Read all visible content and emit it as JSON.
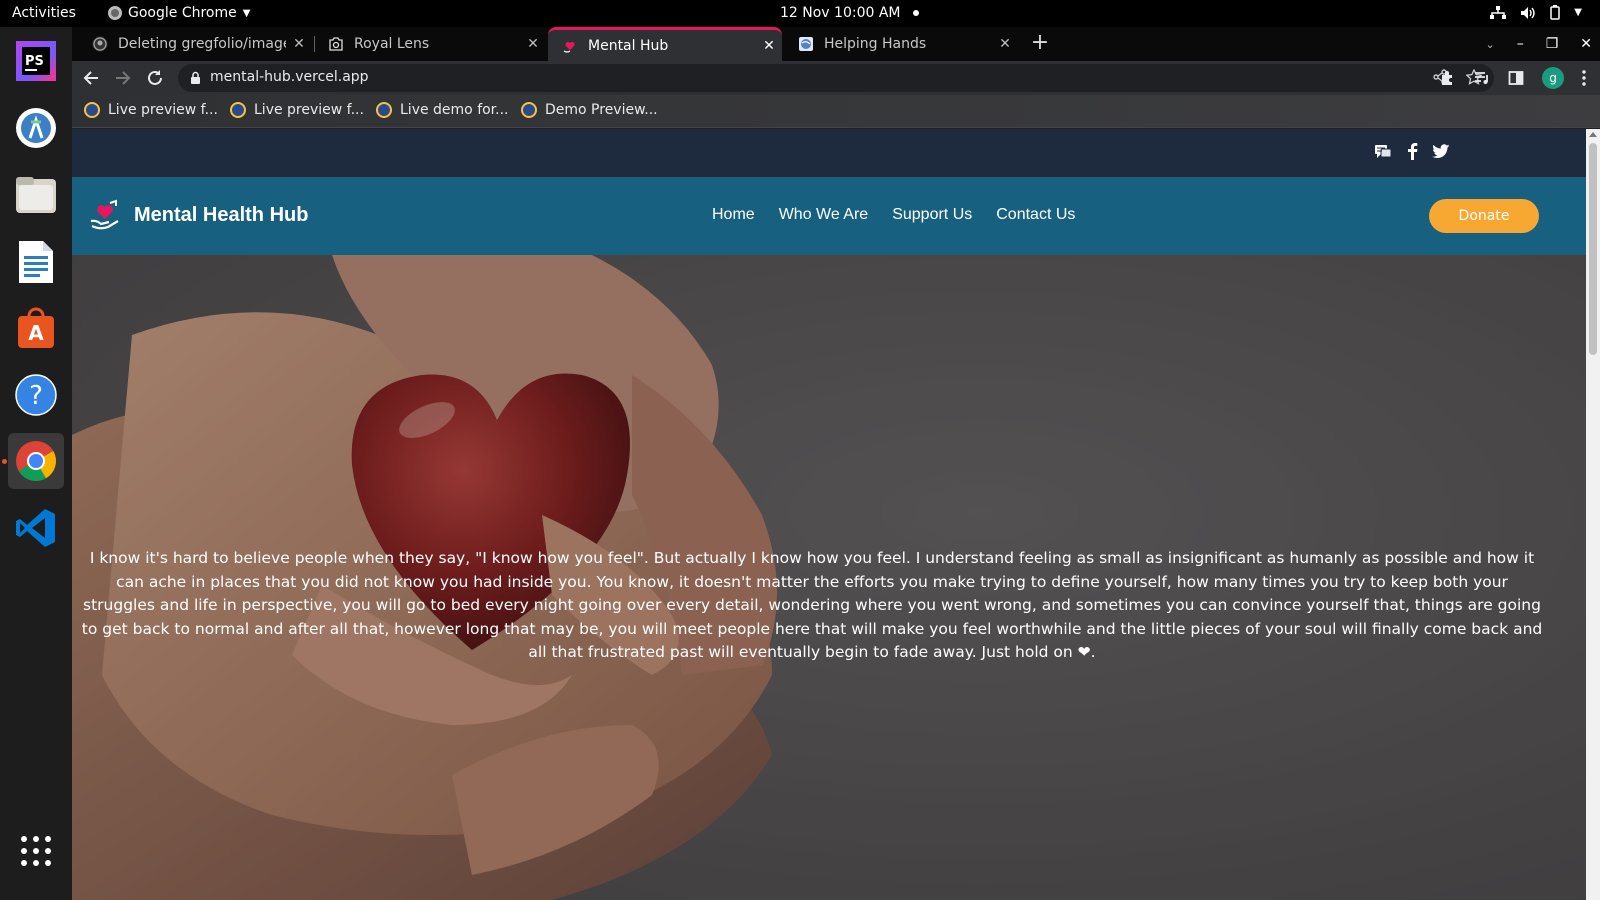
{
  "system": {
    "activities_label": "Activities",
    "app_menu_label": "Google Chrome",
    "clock": "12 Nov  10:00 AM"
  },
  "dock": {
    "apps": [
      "phpstorm-icon",
      "android-studio-icon",
      "files-icon",
      "writer-icon",
      "software-icon",
      "help-icon",
      "chrome-icon",
      "vscode-icon",
      "app-grid-icon"
    ]
  },
  "browser": {
    "tabs": [
      {
        "title": "Deleting gregfolio/image",
        "icon": "github-icon",
        "active": false
      },
      {
        "title": "Royal Lens",
        "icon": "camera-icon",
        "active": false
      },
      {
        "title": "Mental Hub",
        "icon": "heart-hands-icon",
        "active": true
      },
      {
        "title": "Helping Hands",
        "icon": "globe-icon",
        "active": false
      }
    ],
    "url": "mental-hub.vercel.app",
    "bookmarks": [
      {
        "label": "Live preview f..."
      },
      {
        "label": "Live preview f..."
      },
      {
        "label": "Live demo for..."
      },
      {
        "label": "Demo Preview..."
      }
    ],
    "profile_initial": "g"
  },
  "page": {
    "social_icons": [
      "chat-icon",
      "facebook-icon",
      "twitter-icon"
    ],
    "brand_name": "Mental Health Hub",
    "nav": {
      "home": "Home",
      "who_we_are": "Who We Are",
      "support_us": "Support Us",
      "contact_us": "Contact Us"
    },
    "donate_label": "Donate",
    "hero_text": "I know it's hard to believe people when they say, \"I know how you feel\". But actually I know how you feel. I understand feeling as small as insignificant as humanly as possible and how it can ache in places that you did not know you had inside you. You know, it doesn't matter the efforts you make trying to define yourself, how many times you try to keep both your struggles and life in perspective, you will go to bed every night going over every detail, wondering where you went wrong, and sometimes you can convince yourself that, things are going to get back to normal and after all that, however long that may be, you will meet people here that will make you feel worthwhile and the little pieces of your soul will finally come back and all that frustrated past will eventually begin to fade away. Just hold on ❤."
  },
  "colors": {
    "social_bar": "#1e2a3d",
    "nav_bar": "#18607f",
    "donate": "#f7a832",
    "active_tab_accent": "#e8175d"
  }
}
